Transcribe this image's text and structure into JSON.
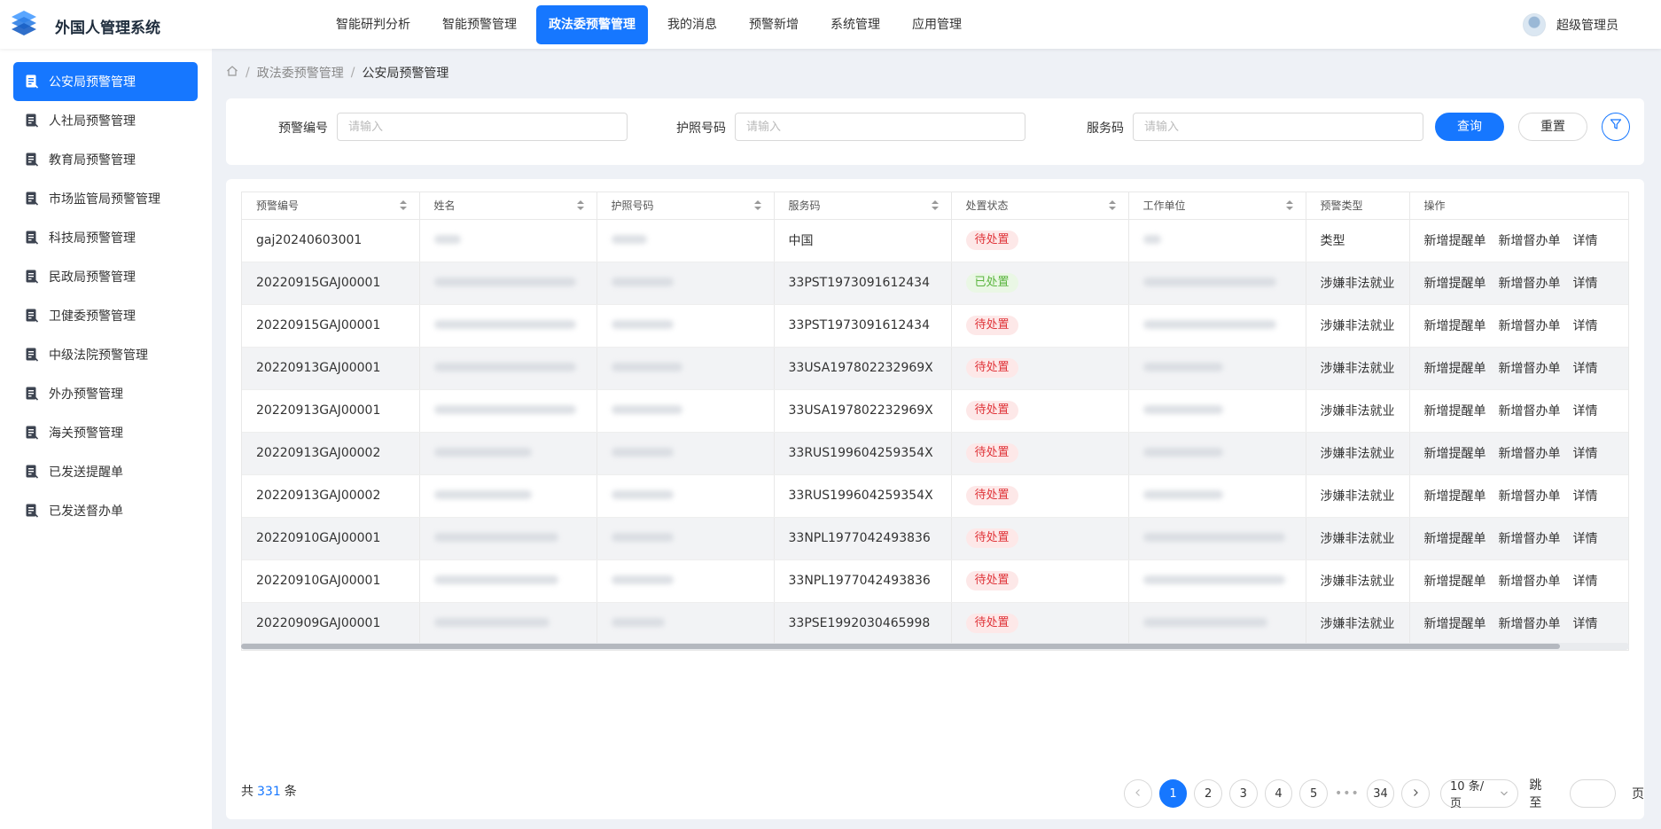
{
  "app": {
    "title": "外国人管理系统"
  },
  "topnav": {
    "items": [
      {
        "label": "智能研判分析"
      },
      {
        "label": "智能预警管理"
      },
      {
        "label": "政法委预警管理",
        "active": true
      },
      {
        "label": "我的消息"
      },
      {
        "label": "预警新增"
      },
      {
        "label": "系统管理"
      },
      {
        "label": "应用管理"
      }
    ]
  },
  "user": {
    "name": "超级管理员"
  },
  "sidebar": {
    "items": [
      {
        "label": "公安局预警管理",
        "active": true
      },
      {
        "label": "人社局预警管理"
      },
      {
        "label": "教育局预警管理"
      },
      {
        "label": "市场监管局预警管理"
      },
      {
        "label": "科技局预警管理"
      },
      {
        "label": "民政局预警管理"
      },
      {
        "label": "卫健委预警管理"
      },
      {
        "label": "中级法院预警管理"
      },
      {
        "label": "外办预警管理"
      },
      {
        "label": "海关预警管理"
      },
      {
        "label": "已发送提醒单"
      },
      {
        "label": "已发送督办单"
      }
    ]
  },
  "breadcrumb": {
    "parent": "政法委预警管理",
    "current": "公安局预警管理"
  },
  "search": {
    "warning_no_label": "预警编号",
    "warning_no_placeholder": "请输入",
    "passport_label": "护照号码",
    "passport_placeholder": "请输入",
    "service_code_label": "服务码",
    "service_code_placeholder": "请输入",
    "query_label": "查询",
    "reset_label": "重置"
  },
  "table": {
    "columns": [
      "预警编号",
      "姓名",
      "护照号码",
      "服务码",
      "处置状态",
      "工作单位",
      "预警类型",
      "操作"
    ],
    "action_labels": [
      "新增提醒单",
      "新增督办单",
      "详情"
    ],
    "rows": [
      {
        "warning_no": "gaj20240603001",
        "service_code": "中国",
        "status": "待处置",
        "status_color": "#e0353a",
        "type": "类型"
      },
      {
        "warning_no": "20220915GAJ00001",
        "service_code": "33PST1973091612434",
        "status": "已处置",
        "status_color": "#5bb53f",
        "type": "涉嫌非法就业"
      },
      {
        "warning_no": "20220915GAJ00001",
        "service_code": "33PST1973091612434",
        "status": "待处置",
        "status_color": "#e0353a",
        "type": "涉嫌非法就业"
      },
      {
        "warning_no": "20220913GAJ00001",
        "service_code": "33USA197802232969X",
        "status": "待处置",
        "status_color": "#e0353a",
        "type": "涉嫌非法就业"
      },
      {
        "warning_no": "20220913GAJ00001",
        "service_code": "33USA197802232969X",
        "status": "待处置",
        "status_color": "#e0353a",
        "type": "涉嫌非法就业"
      },
      {
        "warning_no": "20220913GAJ00002",
        "service_code": "33RUS199604259354X",
        "status": "待处置",
        "status_color": "#e0353a",
        "type": "涉嫌非法就业"
      },
      {
        "warning_no": "20220913GAJ00002",
        "service_code": "33RUS199604259354X",
        "status": "待处置",
        "status_color": "#e0353a",
        "type": "涉嫌非法就业"
      },
      {
        "warning_no": "20220910GAJ00001",
        "service_code": "33NPL1977042493836",
        "status": "待处置",
        "status_color": "#e0353a",
        "type": "涉嫌非法就业"
      },
      {
        "warning_no": "20220910GAJ00001",
        "service_code": "33NPL1977042493836",
        "status": "待处置",
        "status_color": "#e0353a",
        "type": "涉嫌非法就业"
      },
      {
        "warning_no": "20220909GAJ00001",
        "service_code": "33PSE1992030465998",
        "status": "待处置",
        "status_color": "#e0353a",
        "type": "涉嫌非法就业"
      }
    ]
  },
  "footer": {
    "total_prefix": "共",
    "total_count": "331",
    "total_suffix": "条",
    "pages": [
      "1",
      "2",
      "3",
      "4",
      "5"
    ],
    "current_page": "1",
    "last_page": "34",
    "page_size": "10 条/页",
    "jump_label": "跳至",
    "page_label": "页"
  },
  "colors": {
    "primary": "#1677ff",
    "pending": "#e0353a",
    "done": "#5bb53f"
  }
}
